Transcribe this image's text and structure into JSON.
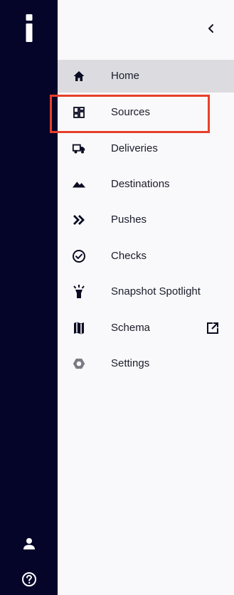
{
  "app": {
    "logo_text": "i",
    "collapse_icon": "chevron-left-icon"
  },
  "rail": {
    "user_icon": "user-icon",
    "help_icon": "help-circle-icon"
  },
  "nav": {
    "items": [
      {
        "label": "Home",
        "icon": "home-icon",
        "active": true
      },
      {
        "label": "Sources",
        "icon": "dashboard-grid-icon",
        "highlighted": true
      },
      {
        "label": "Deliveries",
        "icon": "truck-icon"
      },
      {
        "label": "Destinations",
        "icon": "mountains-icon"
      },
      {
        "label": "Pushes",
        "icon": "double-chevron-right-icon"
      },
      {
        "label": "Checks",
        "icon": "check-circle-icon"
      },
      {
        "label": "Snapshot Spotlight",
        "icon": "spotlight-icon"
      },
      {
        "label": "Schema",
        "icon": "map-icon",
        "trailing_icon": "external-link-icon"
      },
      {
        "label": "Settings",
        "icon": "settings-gear-icon"
      }
    ]
  },
  "colors": {
    "rail_background": "#05052a",
    "panel_background": "#f9f9fb",
    "active_background": "#dcdce0",
    "highlight_border": "#e8402a",
    "text": "#1b1b2b",
    "icon": "#0b0b22"
  }
}
